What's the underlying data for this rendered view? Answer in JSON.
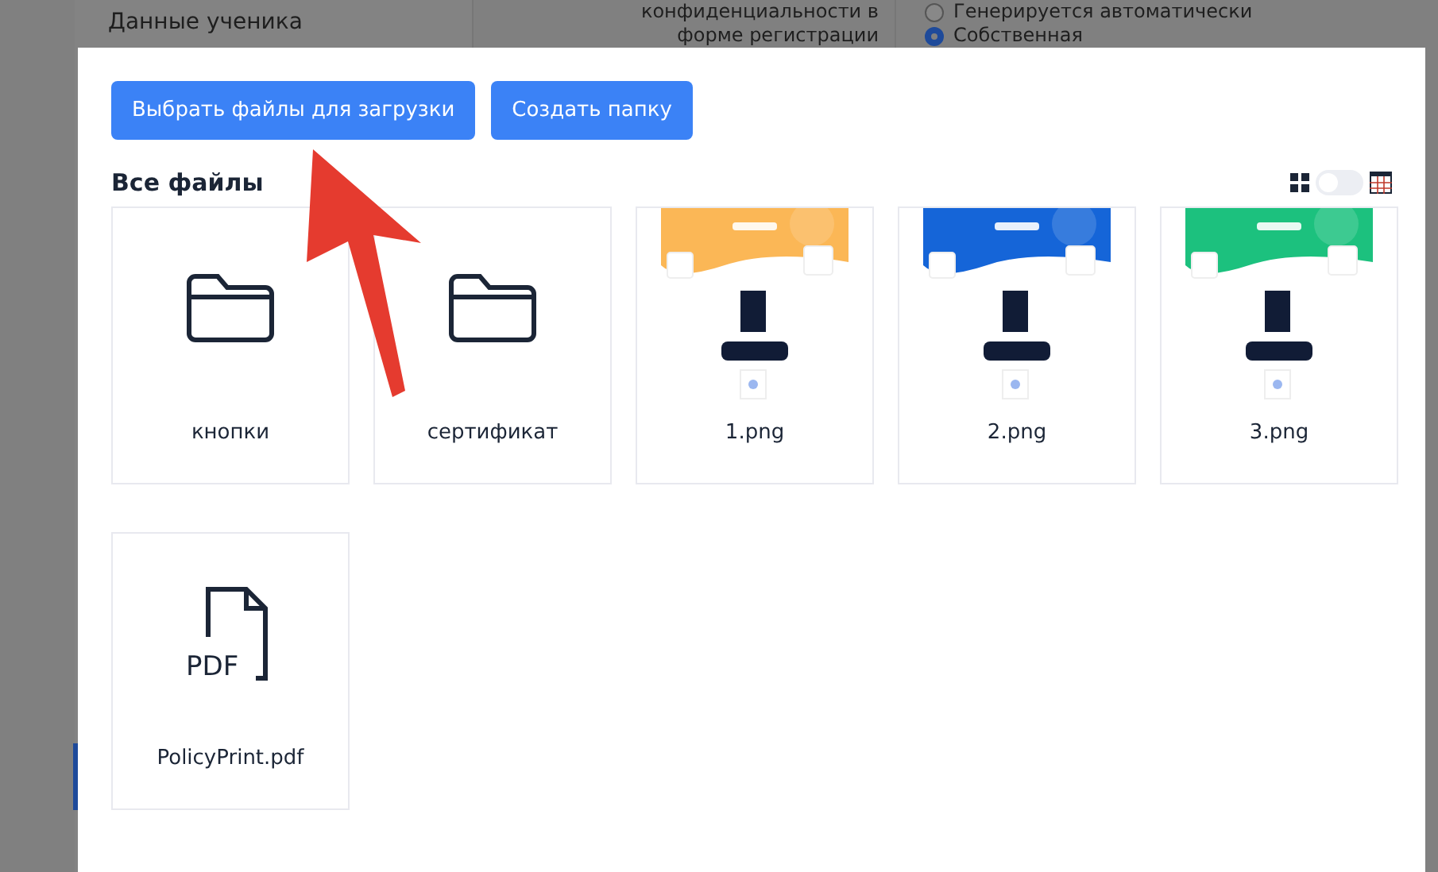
{
  "background": {
    "sidebar_item": "Данные ученика",
    "field_label_lines": [
      "конфиденциальности в",
      "форме регистрации"
    ],
    "radios": [
      {
        "label": "Генерируется автоматически",
        "selected": false
      },
      {
        "label": "Собственная",
        "selected": true
      }
    ]
  },
  "modal": {
    "buttons": [
      "Выбрать файлы для загрузки",
      "Создать папку"
    ],
    "heading": "Все файлы",
    "view_toggle": {
      "on": false
    },
    "files": [
      {
        "kind": "folder",
        "name": "кнопки"
      },
      {
        "kind": "folder",
        "name": "сертификат"
      },
      {
        "name": "1.png",
        "color": "#fbb756"
      },
      {
        "name": "2.png",
        "color": "#1565d8"
      },
      {
        "name": "3.png",
        "color": "#1cc17e"
      },
      {
        "kind": "pdf",
        "name": "PolicyPrint.pdf",
        "icon_label": "PDF"
      }
    ]
  }
}
